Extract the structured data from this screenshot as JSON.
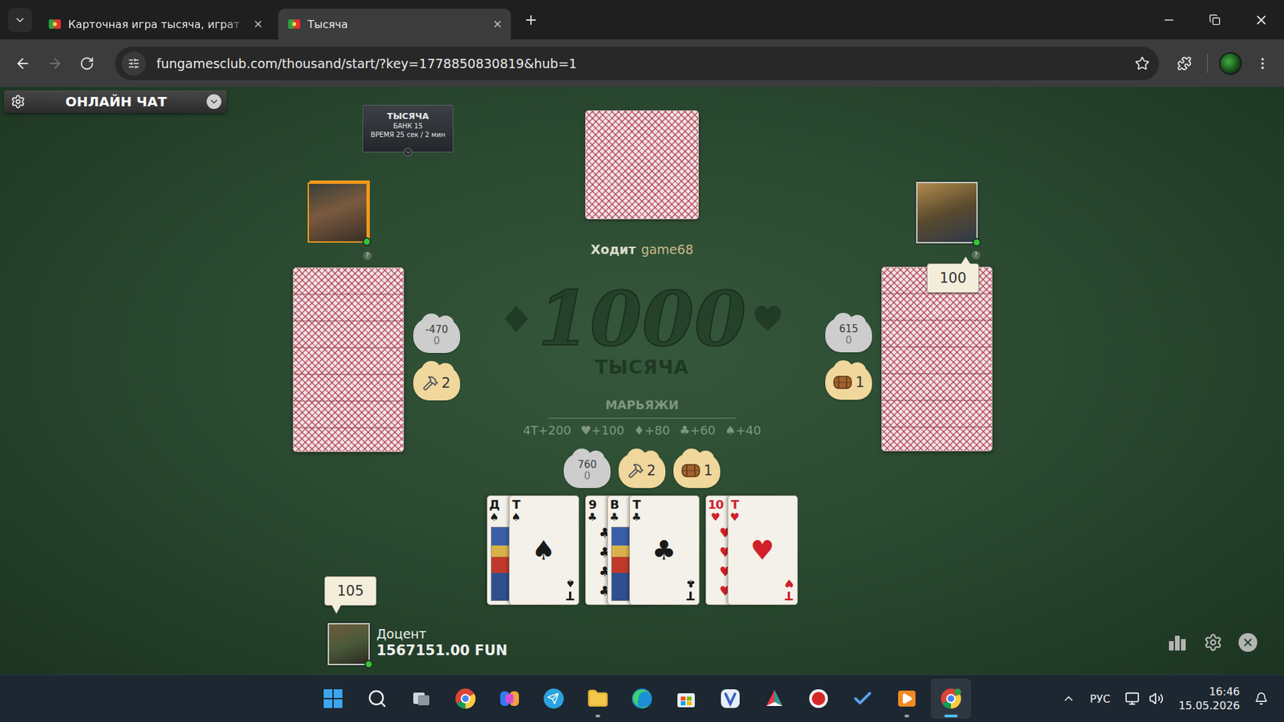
{
  "browser": {
    "tabs": [
      {
        "label": "Карточная игра тысяча, играт",
        "selected": false
      },
      {
        "label": "Тысяча",
        "selected": true
      }
    ],
    "url": "fungamesclub.com/thousand/start/?key=1778850830819&hub=1",
    "bookmarked": false
  },
  "chat": {
    "label": "ОНЛАЙН ЧАТ",
    "expanded": false
  },
  "game_info": {
    "title": "ТЫСЯЧА",
    "lines": [
      "БАНК 15",
      "ВРЕМЯ 25 сек / 2 мин"
    ]
  },
  "turn": {
    "label": "Ходит",
    "player": "game68"
  },
  "logo": {
    "number": "1000",
    "word": "ТЫСЯЧА"
  },
  "marriages": {
    "title": "МАРЬЯЖИ",
    "items": [
      {
        "symbol": "4Т",
        "value": "+200"
      },
      {
        "symbol": "♥",
        "value": "+100"
      },
      {
        "symbol": "♦",
        "value": "+80"
      },
      {
        "symbol": "♣",
        "value": "+60"
      },
      {
        "symbol": "♠",
        "value": "+40"
      }
    ]
  },
  "opponents": [
    {
      "seat": "left",
      "active": true,
      "online": true,
      "info": "?",
      "score": "-470",
      "sub_score": "0",
      "badges": [
        {
          "kind": "hammer",
          "count": "2"
        }
      ]
    },
    {
      "seat": "right",
      "active": false,
      "online": true,
      "info": "?",
      "score": "615",
      "sub_score": "0",
      "bid": "100",
      "badges": [
        {
          "kind": "barrel",
          "count": "1"
        }
      ]
    }
  ],
  "me": {
    "name": "Доцент",
    "balance": "1567151.00 FUN",
    "score": "760",
    "sub_score": "0",
    "bid": "105",
    "online": true,
    "badges": [
      {
        "kind": "hammer",
        "count": "2"
      },
      {
        "kind": "barrel",
        "count": "1"
      }
    ]
  },
  "hand": [
    {
      "cards": [
        {
          "rank": "Д",
          "suit": "♠",
          "kind": "face",
          "color": "#1a1a1a"
        },
        {
          "rank": "Т",
          "suit": "♠",
          "kind": "ace",
          "color": "#1a1a1a"
        }
      ]
    },
    {
      "cards": [
        {
          "rank": "9",
          "suit": "♣",
          "kind": "number",
          "color": "#1a1a1a"
        },
        {
          "rank": "В",
          "suit": "♣",
          "kind": "face",
          "color": "#1a1a1a"
        },
        {
          "rank": "Т",
          "suit": "♣",
          "kind": "ace",
          "color": "#1a1a1a"
        }
      ]
    },
    {
      "cards": [
        {
          "rank": "10",
          "suit": "♥",
          "kind": "number",
          "color": "#d0202a"
        },
        {
          "rank": "Т",
          "suit": "♥",
          "kind": "ace",
          "color": "#d0202a"
        }
      ]
    }
  ],
  "taskbar": {
    "apps": [
      {
        "kind": "start",
        "running": false,
        "active": false
      },
      {
        "kind": "search",
        "running": false,
        "active": false
      },
      {
        "kind": "task-view",
        "running": false,
        "active": false
      },
      {
        "kind": "chrome",
        "running": false,
        "active": false
      },
      {
        "kind": "copilot",
        "running": false,
        "active": false
      },
      {
        "kind": "telegram",
        "running": false,
        "active": false
      },
      {
        "kind": "explorer",
        "running": true,
        "active": false
      },
      {
        "kind": "edge",
        "running": false,
        "active": false
      },
      {
        "kind": "store",
        "running": false,
        "active": false
      },
      {
        "kind": "vivaldi",
        "running": false,
        "active": false
      },
      {
        "kind": "office",
        "running": false,
        "active": false
      },
      {
        "kind": "recorder",
        "running": false,
        "active": false
      },
      {
        "kind": "tasks",
        "running": false,
        "active": false
      },
      {
        "kind": "player",
        "running": true,
        "active": false
      },
      {
        "kind": "chrome-profile",
        "running": true,
        "active": true
      }
    ],
    "tray": {
      "language": "РУС",
      "time": "16:46",
      "date": "15.05.2026"
    }
  }
}
